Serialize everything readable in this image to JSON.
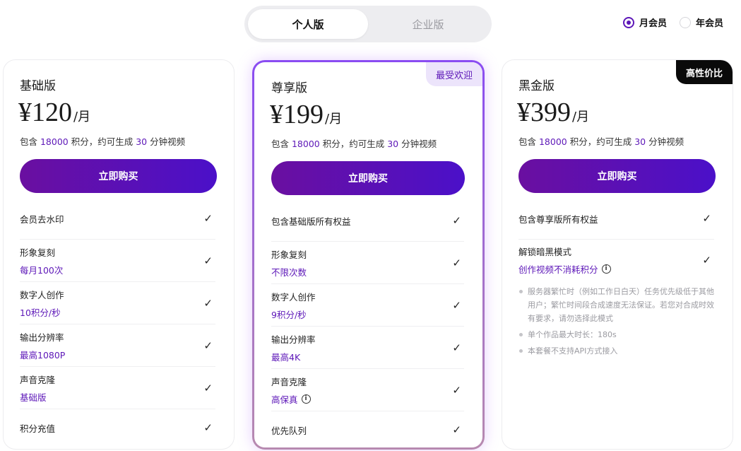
{
  "edition_tabs": [
    {
      "label": "个人版",
      "active": true
    },
    {
      "label": "企业版",
      "active": false
    }
  ],
  "billing": {
    "options": [
      {
        "label": "月会员",
        "selected": true
      },
      {
        "label": "年会员",
        "selected": false
      }
    ]
  },
  "accent_color": "#5d17b8",
  "plans": [
    {
      "name": "基础版",
      "price": "¥120",
      "unit": "/月",
      "credits": {
        "prefix": "包含 ",
        "points": "18000",
        "mid": " 积分，约可生成 ",
        "minutes": "30",
        "suffix": " 分钟视频"
      },
      "buy_label": "立即购买",
      "features": [
        {
          "title": "会员去水印",
          "sub": "",
          "check": "✓"
        },
        {
          "title": "形象复刻",
          "sub": "每月100次",
          "check": "✓"
        },
        {
          "title": "数字人创作",
          "sub": "10积分/秒",
          "check": "✓"
        },
        {
          "title": "输出分辨率",
          "sub": "最高1080P",
          "check": "✓"
        },
        {
          "title": "声音克隆",
          "sub": "基础版",
          "check": "✓"
        },
        {
          "title": "积分充值",
          "sub": "",
          "check": "✓"
        }
      ]
    },
    {
      "name": "尊享版",
      "badge": "最受欢迎",
      "price": "¥199",
      "unit": "/月",
      "credits": {
        "prefix": "包含 ",
        "points": "18000",
        "mid": " 积分，约可生成 ",
        "minutes": "30",
        "suffix": " 分钟视频"
      },
      "buy_label": "立即购买",
      "features": [
        {
          "title": "包含基础版所有权益",
          "sub": "",
          "check": "✓"
        },
        {
          "title": "形象复刻",
          "sub": "不限次数",
          "check": "✓"
        },
        {
          "title": "数字人创作",
          "sub": "9积分/秒",
          "check": "✓"
        },
        {
          "title": "输出分辨率",
          "sub": "最高4K",
          "check": "✓"
        },
        {
          "title": "声音克隆",
          "sub": "高保真",
          "check": "✓",
          "info": "i"
        },
        {
          "title": "优先队列",
          "sub": "",
          "check": "✓"
        }
      ]
    },
    {
      "name": "黑金版",
      "badge": "高性价比",
      "price": "¥399",
      "unit": "/月",
      "credits": {
        "prefix": "包含 ",
        "points": "18000",
        "mid": " 积分，约可生成 ",
        "minutes": "30",
        "suffix": " 分钟视频"
      },
      "buy_label": "立即购买",
      "features": [
        {
          "title": "包含尊享版所有权益",
          "sub": "",
          "check": "✓"
        },
        {
          "title": "解锁暗黑模式",
          "sub": "创作视频不消耗积分",
          "check": "✓",
          "info": "i"
        }
      ],
      "notes": [
        "服务器繁忙时（例如工作日白天）任务优先级低于其他用户；繁忙时间段合成速度无法保证。若您对合成时效有要求，请勿选择此模式",
        "单个作品最大时长：180s",
        "本套餐不支持API方式接入"
      ]
    }
  ]
}
